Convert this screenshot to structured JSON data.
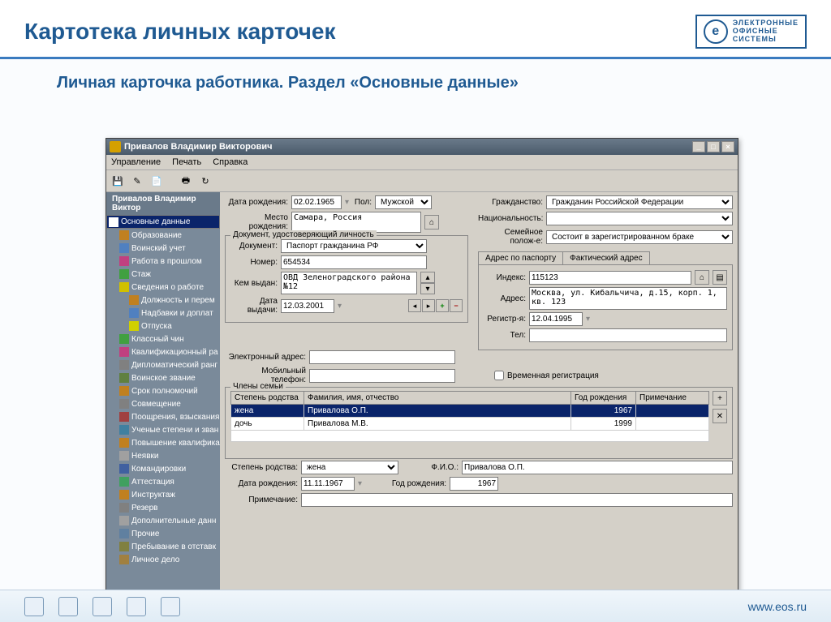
{
  "slide": {
    "title": "Картотека личных карточек",
    "subtitle": "Личная карточка работника. Раздел «Основные данные»",
    "logo_lines": [
      "ЭЛЕКТРОННЫЕ",
      "ОФИСНЫЕ",
      "СИСТЕМЫ"
    ],
    "footer_url": "www.eos.ru"
  },
  "window": {
    "title": "Привалов Владимир Викторович",
    "menu": [
      "Управление",
      "Печать",
      "Справка"
    ]
  },
  "tree": {
    "root": "Привалов Владимир Виктор",
    "items": [
      {
        "label": "Основные данные",
        "sel": true,
        "clr": "#fff"
      },
      {
        "label": "Образование",
        "clr": "#c08020"
      },
      {
        "label": "Воинский учет",
        "clr": "#5080c0"
      },
      {
        "label": "Работа в прошлом",
        "clr": "#c04080"
      },
      {
        "label": "Стаж",
        "clr": "#40a040"
      },
      {
        "label": "Сведения о работе",
        "clr": "#d0c000",
        "grp": true
      },
      {
        "label": "Должность и перем",
        "indent": true,
        "clr": "#c08020"
      },
      {
        "label": "Надбавки и доплат",
        "indent": true,
        "clr": "#5080c0"
      },
      {
        "label": "Отпуска",
        "indent": true,
        "clr": "#d0d000"
      },
      {
        "label": "Классный чин",
        "clr": "#40a040"
      },
      {
        "label": "Квалификационный ра",
        "clr": "#c04080"
      },
      {
        "label": "Дипломатический ранг",
        "clr": "#808080"
      },
      {
        "label": "Воинское звание",
        "clr": "#608040"
      },
      {
        "label": "Срок полномочий",
        "clr": "#c08020"
      },
      {
        "label": "Совмещение",
        "clr": "#808080"
      },
      {
        "label": "Поощрения, взыскания",
        "clr": "#a04040"
      },
      {
        "label": "Ученые степени и зван",
        "clr": "#4080a0"
      },
      {
        "label": "Повышение квалифика",
        "clr": "#c08020"
      },
      {
        "label": "Неявки",
        "clr": "#a0a0a0"
      },
      {
        "label": "Командировки",
        "clr": "#4060a0"
      },
      {
        "label": "Аттестация",
        "clr": "#40a060"
      },
      {
        "label": "Инструктаж",
        "clr": "#c08020"
      },
      {
        "label": "Резерв",
        "clr": "#808080"
      },
      {
        "label": "Дополнительные данн",
        "clr": "#a0a0a0"
      },
      {
        "label": "Прочие",
        "clr": "#6080a0"
      },
      {
        "label": "Пребывание в отставк",
        "clr": "#808040"
      },
      {
        "label": "Личное дело",
        "clr": "#a08040"
      }
    ]
  },
  "form": {
    "birth_date_lbl": "Дата рождения:",
    "birth_date": "02.02.1965",
    "sex_lbl": "Пол:",
    "sex": "Мужской",
    "birthplace_lbl": "Место рождения:",
    "birthplace": "Самара, Россия",
    "citizenship_lbl": "Гражданство:",
    "citizenship": "Гражданин Российской Федерации",
    "nationality_lbl": "Национальность:",
    "nationality": "",
    "marital_lbl": "Семейное полож-е:",
    "marital": "Состоит в зарегистрированном браке",
    "iddoc_legend": "Документ, удостоверяющий личность",
    "doc_lbl": "Документ:",
    "doc": "Паспорт гражданина РФ",
    "num_lbl": "Номер:",
    "num": "654534",
    "issued_lbl": "Кем выдан:",
    "issued": "ОВД Зеленоградского района №12",
    "issue_date_lbl": "Дата выдачи:",
    "issue_date": "12.03.2001",
    "addr_tab1": "Адрес по паспорту",
    "addr_tab2": "Фактический адрес",
    "index_lbl": "Индекс:",
    "index": "115123",
    "addr_lbl": "Адрес:",
    "addr": "Москва, ул. Кибальчича, д.15, корп. 1, кв. 123",
    "reg_lbl": "Регистр-я:",
    "reg": "12.04.1995",
    "tel_lbl": "Тел:",
    "tel": "",
    "email_lbl": "Электронный адрес:",
    "email": "",
    "mobile_lbl": "Мобильный телефон:",
    "mobile": "",
    "tempreg_lbl": "Временная регистрация",
    "family_legend": "Члены семьи",
    "family_cols": [
      "Степень родства",
      "Фамилия, имя, отчество",
      "Год рождения",
      "Примечание"
    ],
    "family_rows": [
      {
        "rel": "жена",
        "fio": "Привалова О.П.",
        "year": "1967",
        "note": "",
        "sel": true
      },
      {
        "rel": "дочь",
        "fio": "Привалова М.В.",
        "year": "1999",
        "note": ""
      }
    ],
    "detail_rel_lbl": "Степень родства:",
    "detail_rel": "жена",
    "detail_fio_lbl": "Ф.И.О.:",
    "detail_fio": "Привалова О.П.",
    "detail_bd_lbl": "Дата рождения:",
    "detail_bd": "11.11.1967",
    "detail_year_lbl": "Год рождения:",
    "detail_year": "1967",
    "detail_note_lbl": "Примечание:",
    "detail_note": ""
  }
}
